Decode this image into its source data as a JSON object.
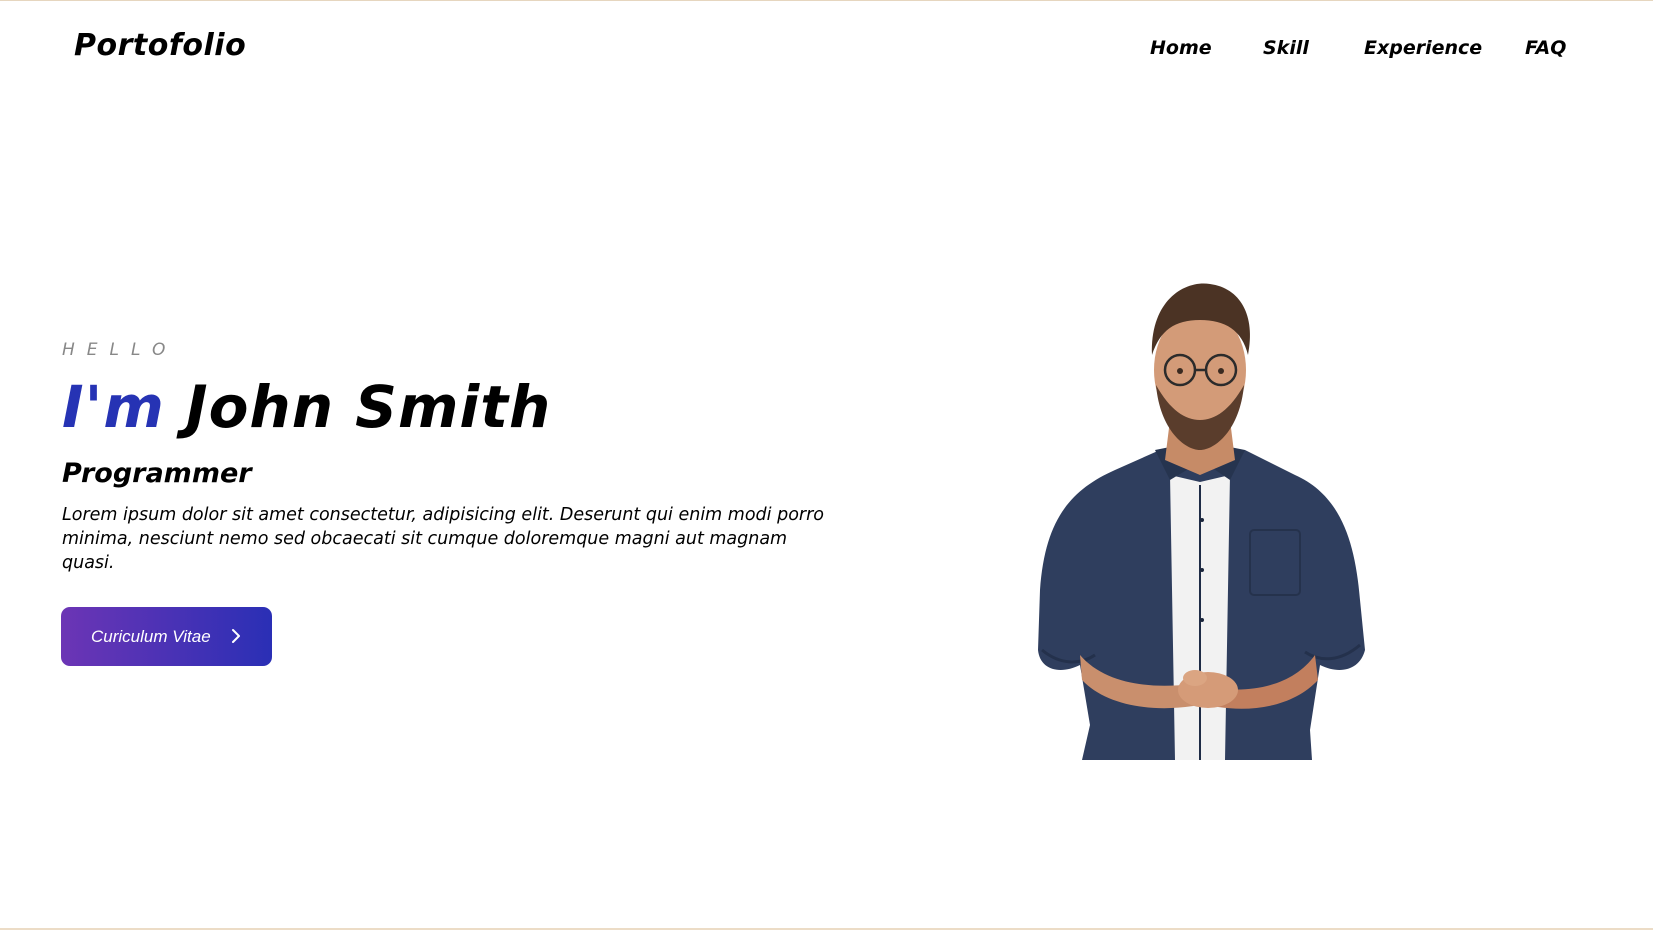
{
  "header": {
    "logo": "Portofolio",
    "nav": [
      {
        "label": "Home"
      },
      {
        "label": "Skill"
      },
      {
        "label": "Experience"
      },
      {
        "label": "FAQ"
      }
    ]
  },
  "hero": {
    "greeting": "HELLO",
    "headline_accent": "I'm",
    "headline_name": "John Smith",
    "role": "Programmer",
    "intro": "Lorem ipsum dolor sit amet consectetur, adipisicing elit. Deserunt qui enim modi porro minima, nesciunt nemo sed obcaecati sit cumque doloremque magni aut magnam quasi.",
    "cta_label": "Curiculum Vitae",
    "cta_icon": "chevron-right-icon"
  },
  "colors": {
    "accent": "#2633b4",
    "button_gradient_start": "#6c35b5",
    "button_gradient_end": "#2a2fb5",
    "shirt": "#2f3e5e"
  }
}
